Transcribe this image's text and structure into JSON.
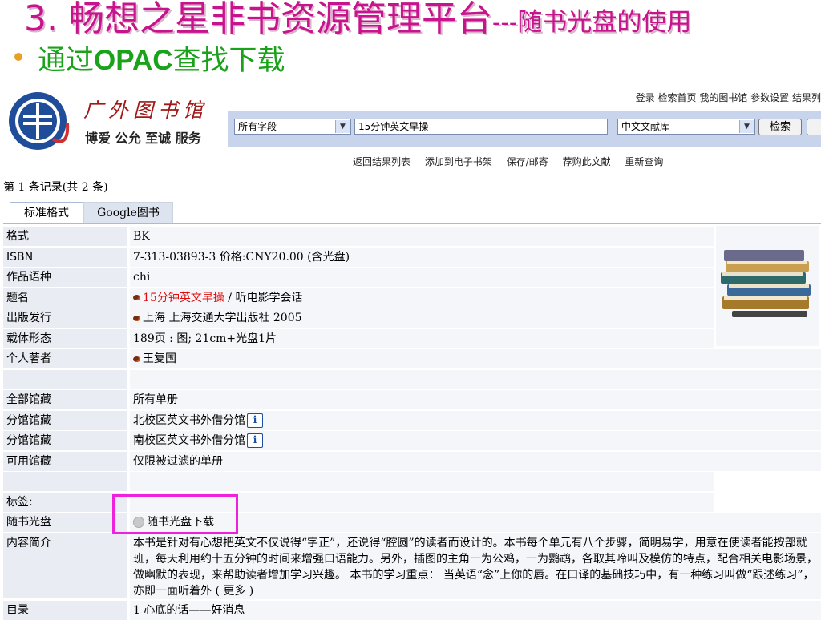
{
  "slide": {
    "title_main": "3. 畅想之星非书资源管理平台",
    "title_sub": "---随书光盘的使用",
    "bullet": "通过OPAC查找下载",
    "bullet_prefix": "通过",
    "bullet_bold": "OPAC",
    "bullet_suffix": "查找下载"
  },
  "library": {
    "logo_name": "广外图书馆",
    "logo_motto": "博爱 公允 至诚 服务"
  },
  "top_links": "登录 检索首页 我的图书馆 参数设置 结果列",
  "search": {
    "field_select": "所有字段",
    "query": "15分钟英文早操",
    "db_select": "中文文献库",
    "search_button": "检索"
  },
  "actions": [
    "返回结果列表",
    "添加到电子书架",
    "保存/邮寄",
    "荐购此文献",
    "重新查询"
  ],
  "record_count": "第 1 条记录(共 2 条)",
  "tabs": [
    "标准格式",
    "Google图书"
  ],
  "rows": [
    {
      "label": "格式",
      "value": "BK"
    },
    {
      "label": "ISBN",
      "value": "7-313-03893-3 价格:CNY20.00 (含光盘)"
    },
    {
      "label": "作品语种",
      "value": "chi"
    },
    {
      "label": "题名",
      "value_link": "15分钟英文早操",
      "value_rest": " / 听电影学会话"
    },
    {
      "label": "出版发行",
      "value": "上海 上海交通大学出版社 2005"
    },
    {
      "label": "载体形态",
      "value": "189页 : 图; 21cm+光盘1片"
    },
    {
      "label": "个人著者",
      "value": "王复国"
    },
    {
      "label": "",
      "value": ""
    },
    {
      "label": "全部馆藏",
      "value": "所有单册"
    },
    {
      "label": "分馆馆藏",
      "value": "北校区英文书外借分馆"
    },
    {
      "label": "分馆馆藏",
      "value": "南校区英文书外借分馆"
    },
    {
      "label": "可用馆藏",
      "value": "仅限被过滤的单册"
    },
    {
      "label": "",
      "value": ""
    },
    {
      "label": "标签:",
      "value": ""
    },
    {
      "label": "随书光盘",
      "value": "随书光盘下载"
    }
  ],
  "description": {
    "label": "内容简介",
    "text": "本书是针对有心想把英文不仅说得“字正”，还说得“腔圆”的读者而设计的。本书每个单元有八个步骤，简明易学，用意在使读者能按部就班，每天利用约十五分钟的时间来增强口语能力。另外，插图的主角一为公鸡，一为鹦鹉，各取其啼叫及模仿的特点，配合相关电影场景，做幽默的表现，来帮助读者增加学习兴趣。 本书的学习重点： 当英语“念”上你的唇。在口译的基础技巧中，有一种练习叫做“跟述练习”，亦即一面听着外 ( 更多 )"
  },
  "toc": {
    "label": "目录",
    "value": "1 心底的话——好消息"
  },
  "colors": {
    "title": "#c8148c",
    "bullet": "#1aa21a",
    "highlight_box": "#ee22dd",
    "search_bar": "#c8d4ec"
  }
}
